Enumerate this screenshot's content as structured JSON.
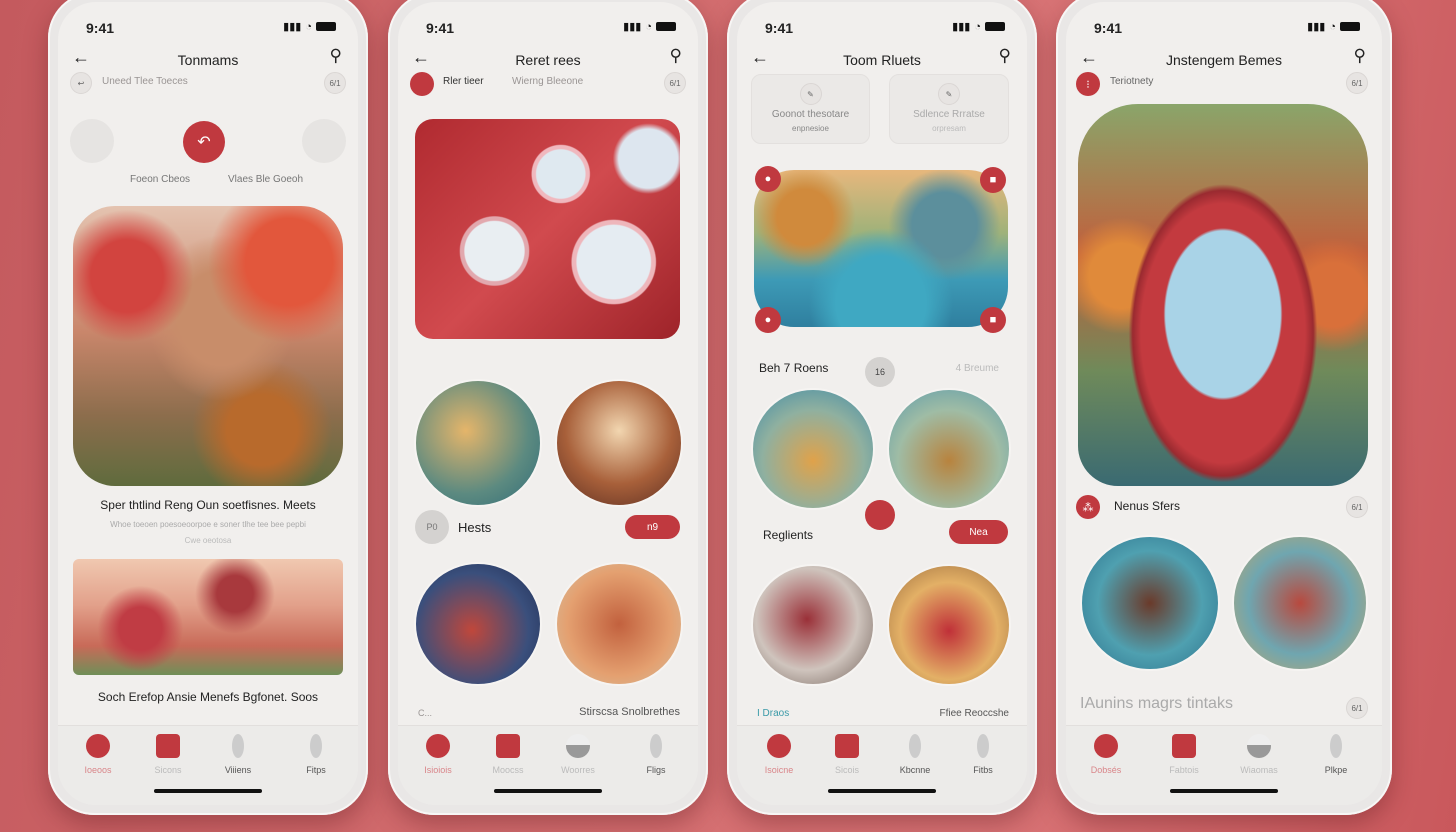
{
  "status_time": "9:41",
  "colors": {
    "accent": "#c0393f",
    "background": "#d26c6e"
  },
  "phones": [
    {
      "title": "Tonmams",
      "row_label": "Uneed Tlee Toeces",
      "row_badge": "6/1",
      "carousel": {
        "left_label": "Foeon Cbeos",
        "right_label": "Vlaes Ble Goeoh"
      },
      "card_title": "Sper thtlind Reng Oun soetfisnes. Meets",
      "card_subtitle": "Whoe toeoen poesoeoorpoe e soner tlhe tee bee pepbi",
      "card_meta": "Cwe oeotosa",
      "card2_title": "Soch Erefop Ansie Menefs Bgfonet. Soos",
      "tabs": [
        "Ioeoos",
        "Sicons",
        "Viiiens",
        "Fitps"
      ]
    },
    {
      "title": "Reret rees",
      "row_label": "Rler tieer",
      "row_label2": "Wierng Bleeone",
      "row_badge": "6/1",
      "list_item": {
        "avatar": "P0",
        "label": "Hests",
        "button": "n9"
      },
      "footer_left": "C...",
      "footer_right": "Stirscsa Snolbrethes",
      "tabs": [
        "Isioiois",
        "Moocss",
        "Woorres",
        "Fligs"
      ]
    },
    {
      "title": "Toom Rluets",
      "cards": [
        {
          "title": "Goonot thesotare",
          "sub": "enpnesioe"
        },
        {
          "title": "Sdlence Rrratse",
          "sub": "orpresam"
        }
      ],
      "section1": {
        "label": "Beh 7 Roens",
        "count": "16",
        "right": "4 Breume"
      },
      "section2": {
        "label": "Reglients",
        "button": "Nea"
      },
      "footer_left": "I Draos",
      "footer_right": "Ffiee Reoccshe",
      "tabs": [
        "Isoicne",
        "Sicois",
        "Kbcnne",
        "Fitbs"
      ]
    },
    {
      "title": "Jnstengem Bemes",
      "row_label": "Teriotnety",
      "row_badge": "6/1",
      "section": {
        "label": "Nenus Sfers",
        "badge": "6/1"
      },
      "footer_text": "IAunins magrs tintaks",
      "footer_badge": "6/1",
      "tabs": [
        "Dobsés",
        "Fabtois",
        "Wiaomas",
        "Plkpe"
      ]
    }
  ]
}
